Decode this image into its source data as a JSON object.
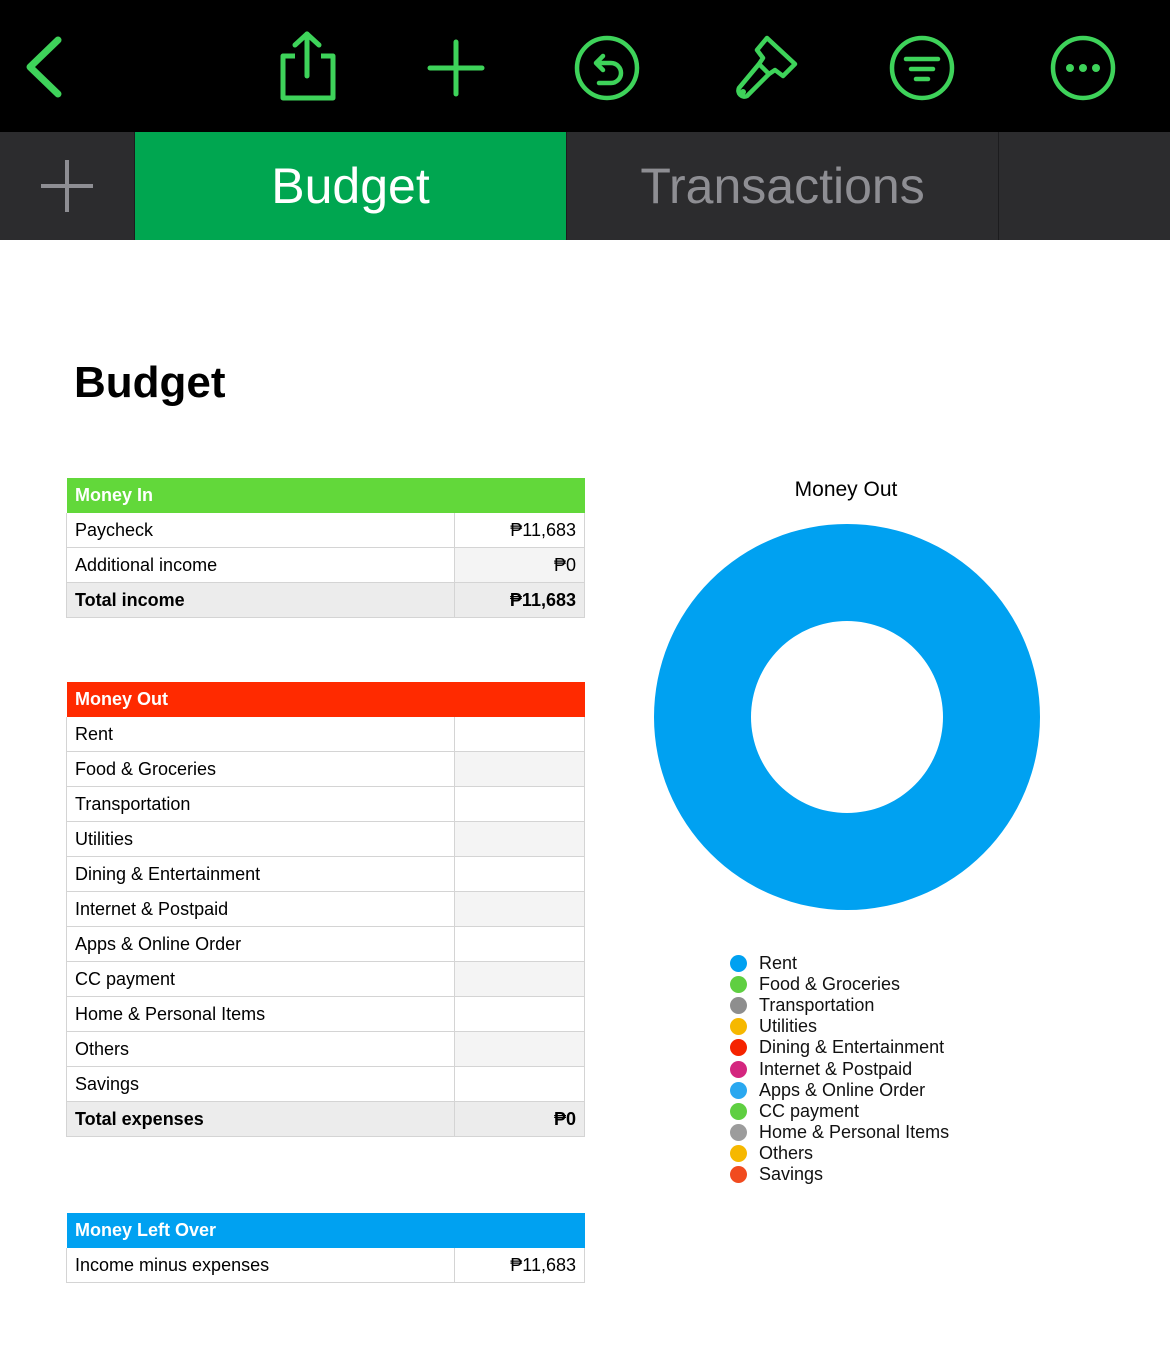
{
  "toolbar": {
    "accent": "#3ed35a",
    "buttons": [
      {
        "name": "back-button",
        "icon": "chevron-left-icon"
      },
      {
        "name": "share-button",
        "icon": "share-icon"
      },
      {
        "name": "add-button",
        "icon": "plus-icon"
      },
      {
        "name": "undo-button",
        "icon": "undo-icon"
      },
      {
        "name": "format-button",
        "icon": "paintbrush-icon"
      },
      {
        "name": "organize-button",
        "icon": "filter-icon"
      },
      {
        "name": "more-button",
        "icon": "more-icon"
      }
    ]
  },
  "tabs": {
    "add_icon": "plus-icon",
    "items": [
      {
        "label": "Budget",
        "active": true,
        "color": "#00a650"
      },
      {
        "label": "Transactions",
        "active": false
      }
    ]
  },
  "page": {
    "title": "Budget"
  },
  "money_in": {
    "header": "Money In",
    "color": "#62d83a",
    "rows": [
      {
        "label": "Paycheck",
        "value": "₱11,683"
      },
      {
        "label": "Additional income",
        "value": "₱0"
      }
    ],
    "total": {
      "label": "Total income",
      "value": "₱11,683"
    }
  },
  "money_out": {
    "header": "Money Out",
    "color": "#ff2a00",
    "rows": [
      {
        "label": "Rent",
        "value": ""
      },
      {
        "label": "Food & Groceries",
        "value": ""
      },
      {
        "label": "Transportation",
        "value": ""
      },
      {
        "label": "Utilities",
        "value": ""
      },
      {
        "label": "Dining & Entertainment",
        "value": ""
      },
      {
        "label": "Internet & Postpaid",
        "value": ""
      },
      {
        "label": "Apps & Online Order",
        "value": ""
      },
      {
        "label": "CC payment",
        "value": ""
      },
      {
        "label": "Home & Personal Items",
        "value": ""
      },
      {
        "label": "Others",
        "value": ""
      },
      {
        "label": "Savings",
        "value": ""
      }
    ],
    "total": {
      "label": "Total expenses",
      "value": "₱0"
    }
  },
  "money_left": {
    "header": "Money Left Over",
    "color": "#00a1f1",
    "rows": [
      {
        "label": "Income minus expenses",
        "value": "₱11,683"
      }
    ]
  },
  "chart_data": {
    "type": "pie",
    "title": "Money Out",
    "donut": true,
    "legend_position": "bottom",
    "categories": [
      "Rent",
      "Food & Groceries",
      "Transportation",
      "Utilities",
      "Dining & Entertainment",
      "Internet & Postpaid",
      "Apps & Online Order",
      "CC payment",
      "Home & Personal Items",
      "Others",
      "Savings"
    ],
    "values": [
      1,
      0,
      0,
      0,
      0,
      0,
      0,
      0,
      0,
      0,
      0
    ],
    "colors": [
      "#00a1f1",
      "#5fcf41",
      "#8e8e8e",
      "#f6b800",
      "#f52300",
      "#d4267f",
      "#2aa8f0",
      "#5fcf41",
      "#9c9c9c",
      "#f6b800",
      "#f14b1f"
    ]
  }
}
